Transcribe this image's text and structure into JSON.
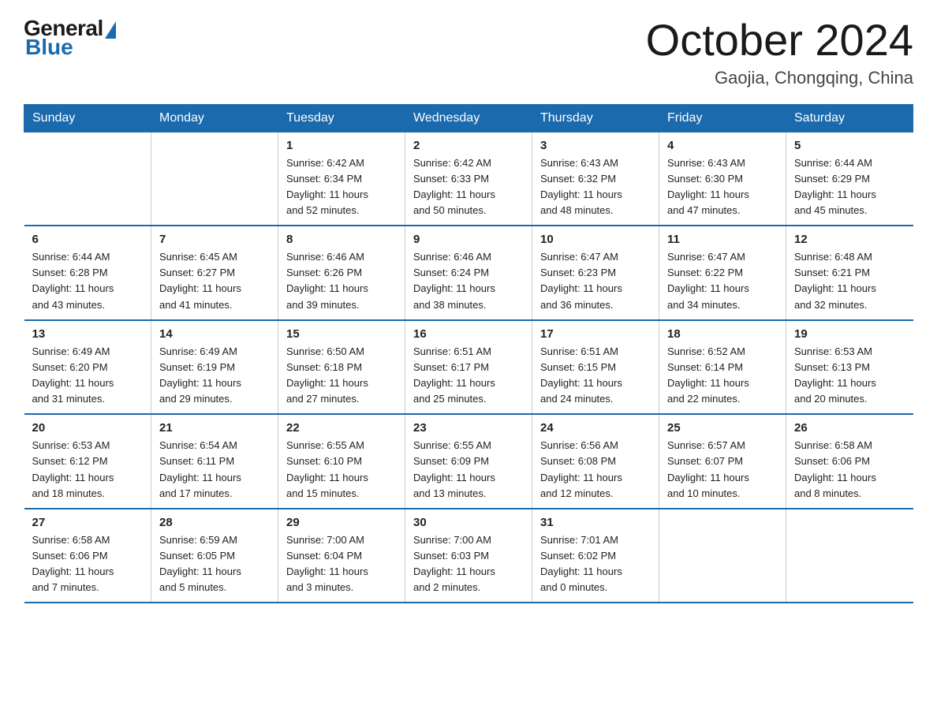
{
  "logo": {
    "general": "General",
    "blue": "Blue"
  },
  "header": {
    "title": "October 2024",
    "location": "Gaojia, Chongqing, China"
  },
  "days_of_week": [
    "Sunday",
    "Monday",
    "Tuesday",
    "Wednesday",
    "Thursday",
    "Friday",
    "Saturday"
  ],
  "weeks": [
    [
      {
        "day": "",
        "info": ""
      },
      {
        "day": "",
        "info": ""
      },
      {
        "day": "1",
        "info": "Sunrise: 6:42 AM\nSunset: 6:34 PM\nDaylight: 11 hours\nand 52 minutes."
      },
      {
        "day": "2",
        "info": "Sunrise: 6:42 AM\nSunset: 6:33 PM\nDaylight: 11 hours\nand 50 minutes."
      },
      {
        "day": "3",
        "info": "Sunrise: 6:43 AM\nSunset: 6:32 PM\nDaylight: 11 hours\nand 48 minutes."
      },
      {
        "day": "4",
        "info": "Sunrise: 6:43 AM\nSunset: 6:30 PM\nDaylight: 11 hours\nand 47 minutes."
      },
      {
        "day": "5",
        "info": "Sunrise: 6:44 AM\nSunset: 6:29 PM\nDaylight: 11 hours\nand 45 minutes."
      }
    ],
    [
      {
        "day": "6",
        "info": "Sunrise: 6:44 AM\nSunset: 6:28 PM\nDaylight: 11 hours\nand 43 minutes."
      },
      {
        "day": "7",
        "info": "Sunrise: 6:45 AM\nSunset: 6:27 PM\nDaylight: 11 hours\nand 41 minutes."
      },
      {
        "day": "8",
        "info": "Sunrise: 6:46 AM\nSunset: 6:26 PM\nDaylight: 11 hours\nand 39 minutes."
      },
      {
        "day": "9",
        "info": "Sunrise: 6:46 AM\nSunset: 6:24 PM\nDaylight: 11 hours\nand 38 minutes."
      },
      {
        "day": "10",
        "info": "Sunrise: 6:47 AM\nSunset: 6:23 PM\nDaylight: 11 hours\nand 36 minutes."
      },
      {
        "day": "11",
        "info": "Sunrise: 6:47 AM\nSunset: 6:22 PM\nDaylight: 11 hours\nand 34 minutes."
      },
      {
        "day": "12",
        "info": "Sunrise: 6:48 AM\nSunset: 6:21 PM\nDaylight: 11 hours\nand 32 minutes."
      }
    ],
    [
      {
        "day": "13",
        "info": "Sunrise: 6:49 AM\nSunset: 6:20 PM\nDaylight: 11 hours\nand 31 minutes."
      },
      {
        "day": "14",
        "info": "Sunrise: 6:49 AM\nSunset: 6:19 PM\nDaylight: 11 hours\nand 29 minutes."
      },
      {
        "day": "15",
        "info": "Sunrise: 6:50 AM\nSunset: 6:18 PM\nDaylight: 11 hours\nand 27 minutes."
      },
      {
        "day": "16",
        "info": "Sunrise: 6:51 AM\nSunset: 6:17 PM\nDaylight: 11 hours\nand 25 minutes."
      },
      {
        "day": "17",
        "info": "Sunrise: 6:51 AM\nSunset: 6:15 PM\nDaylight: 11 hours\nand 24 minutes."
      },
      {
        "day": "18",
        "info": "Sunrise: 6:52 AM\nSunset: 6:14 PM\nDaylight: 11 hours\nand 22 minutes."
      },
      {
        "day": "19",
        "info": "Sunrise: 6:53 AM\nSunset: 6:13 PM\nDaylight: 11 hours\nand 20 minutes."
      }
    ],
    [
      {
        "day": "20",
        "info": "Sunrise: 6:53 AM\nSunset: 6:12 PM\nDaylight: 11 hours\nand 18 minutes."
      },
      {
        "day": "21",
        "info": "Sunrise: 6:54 AM\nSunset: 6:11 PM\nDaylight: 11 hours\nand 17 minutes."
      },
      {
        "day": "22",
        "info": "Sunrise: 6:55 AM\nSunset: 6:10 PM\nDaylight: 11 hours\nand 15 minutes."
      },
      {
        "day": "23",
        "info": "Sunrise: 6:55 AM\nSunset: 6:09 PM\nDaylight: 11 hours\nand 13 minutes."
      },
      {
        "day": "24",
        "info": "Sunrise: 6:56 AM\nSunset: 6:08 PM\nDaylight: 11 hours\nand 12 minutes."
      },
      {
        "day": "25",
        "info": "Sunrise: 6:57 AM\nSunset: 6:07 PM\nDaylight: 11 hours\nand 10 minutes."
      },
      {
        "day": "26",
        "info": "Sunrise: 6:58 AM\nSunset: 6:06 PM\nDaylight: 11 hours\nand 8 minutes."
      }
    ],
    [
      {
        "day": "27",
        "info": "Sunrise: 6:58 AM\nSunset: 6:06 PM\nDaylight: 11 hours\nand 7 minutes."
      },
      {
        "day": "28",
        "info": "Sunrise: 6:59 AM\nSunset: 6:05 PM\nDaylight: 11 hours\nand 5 minutes."
      },
      {
        "day": "29",
        "info": "Sunrise: 7:00 AM\nSunset: 6:04 PM\nDaylight: 11 hours\nand 3 minutes."
      },
      {
        "day": "30",
        "info": "Sunrise: 7:00 AM\nSunset: 6:03 PM\nDaylight: 11 hours\nand 2 minutes."
      },
      {
        "day": "31",
        "info": "Sunrise: 7:01 AM\nSunset: 6:02 PM\nDaylight: 11 hours\nand 0 minutes."
      },
      {
        "day": "",
        "info": ""
      },
      {
        "day": "",
        "info": ""
      }
    ]
  ]
}
